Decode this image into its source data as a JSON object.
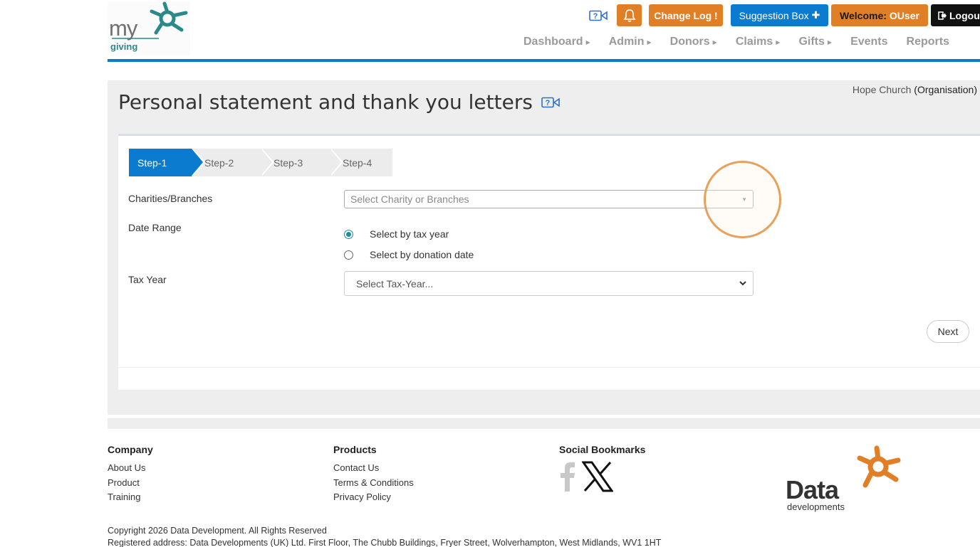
{
  "brand": {
    "logo_word": "my",
    "logo_sub": "giving",
    "teal": "#2a8a8a"
  },
  "topbar": {
    "video_help_icon": "video-help-icon",
    "bell_icon": "bell-icon",
    "change_log_label": "Change Log",
    "change_log_mark": "!",
    "suggestion_label": "Suggestion Box",
    "suggestion_mark": "✚",
    "welcome_label": "Welcome:",
    "welcome_user": "OUser",
    "logout_label": "Logout",
    "colors": {
      "orange": "#e07f26",
      "blue": "#0b7bd0",
      "black": "#111111"
    }
  },
  "nav": {
    "items": [
      {
        "label": "Dashboard",
        "caret": "▶"
      },
      {
        "label": "Admin",
        "caret": "▶"
      },
      {
        "label": "Donors",
        "caret": "▶"
      },
      {
        "label": "Claims",
        "caret": "▶"
      },
      {
        "label": "Gifts",
        "caret": "▶"
      },
      {
        "label": "Events",
        "caret": ""
      },
      {
        "label": "Reports",
        "caret": ""
      }
    ]
  },
  "page": {
    "title": "Personal statement and thank you letters",
    "org_name": "Hope Church",
    "org_type": "(Organisation)"
  },
  "wizard": {
    "steps": [
      "Step-1",
      "Step-2",
      "Step-3",
      "Step-4"
    ],
    "active_step": "Step-1"
  },
  "form": {
    "charities_label": "Charities/Branches",
    "charities_placeholder": "Select Charity or Branches",
    "date_range_label": "Date Range",
    "radio_tax_year": "Select by tax year",
    "radio_donation_date": "Select by donation date",
    "radio_selected": "Select by tax year",
    "tax_year_label": "Tax Year",
    "tax_year_value": "Select Tax-Year...",
    "next_label": "Next"
  },
  "footer": {
    "company_heading": "Company",
    "company_links": [
      "About Us",
      "Product",
      "Training"
    ],
    "products_heading": "Products",
    "products_links": [
      "Contact Us",
      "Terms & Conditions",
      "Privacy Policy"
    ],
    "social_heading": "Social Bookmarks",
    "social_icons": [
      "facebook-icon",
      "x-icon"
    ],
    "dd_logo_main": "Data",
    "dd_logo_sub": "developments",
    "copyright": "Copyright 2026 Data Development. All Rights Reserved",
    "address": "Registered address: Data Developments (UK) Ltd. First Floor, The Chubb Buildings, Fryer Street, Wolverhampton, West Midlands, WV1 1HT"
  }
}
